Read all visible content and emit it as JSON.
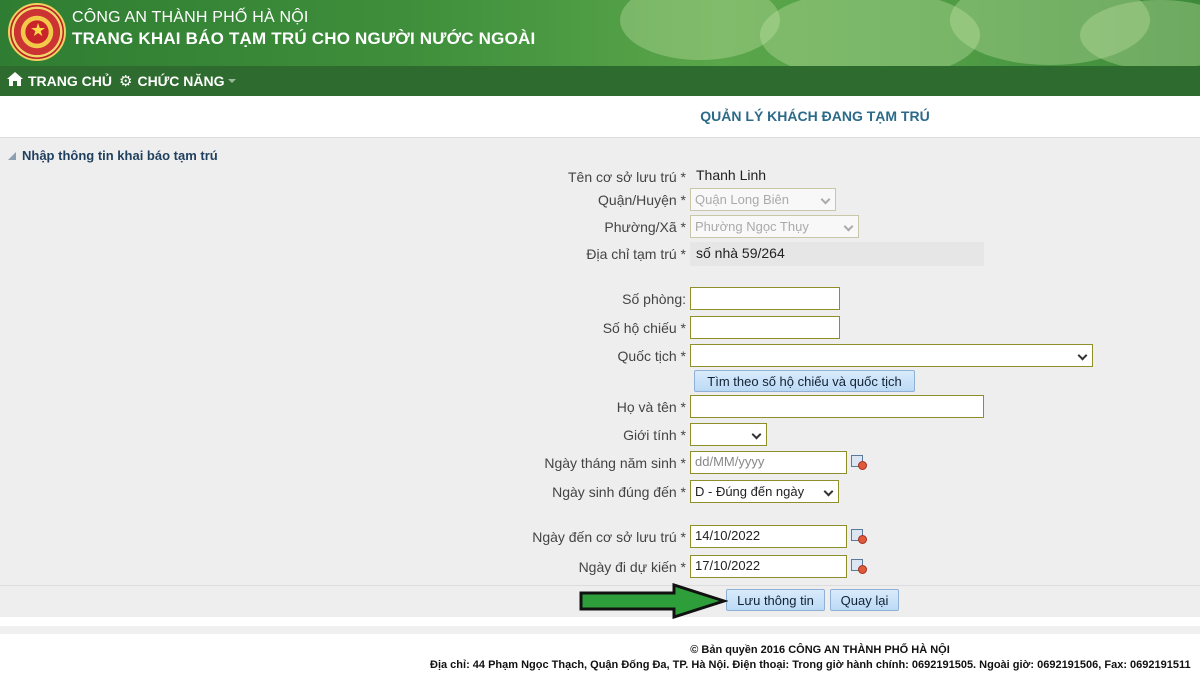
{
  "header": {
    "org_name": "CÔNG AN THÀNH PHỐ HÀ NỘI",
    "site_title": "TRANG KHAI BÁO TẠM TRÚ CHO NGƯỜI NƯỚC NGOÀI",
    "logo_icon": "police-emblem-icon"
  },
  "nav": {
    "home_label": "TRANG CHỦ",
    "home_icon": "home-icon",
    "functions_label": "CHỨC NĂNG",
    "functions_icon": "gear-icon"
  },
  "page_title": "QUẢN LÝ KHÁCH ĐANG TẠM TRÚ",
  "form": {
    "section_title": "Nhập thông tin khai báo tạm trú",
    "fields": {
      "accommodation_label": "Tên cơ sở lưu trú *",
      "accommodation_value": "Thanh Linh",
      "district_label": "Quận/Huyện *",
      "district_value": "Quận Long Biên",
      "ward_label": "Phường/Xã *",
      "ward_value": "Phường Ngọc Thụy",
      "address_label": "Địa chỉ tạm trú *",
      "address_value": "số nhà 59/264",
      "room_label": "Số phòng:",
      "room_value": "",
      "passport_label": "Số hộ chiếu *",
      "passport_value": "",
      "nationality_label": "Quốc tịch *",
      "nationality_value": "",
      "search_button": "Tìm theo số hộ chiếu và quốc tịch",
      "fullname_label": "Họ và tên *",
      "fullname_value": "",
      "gender_label": "Giới tính *",
      "gender_value": "",
      "dob_label": "Ngày tháng năm sinh *",
      "dob_placeholder": "dd/MM/yyyy",
      "dob_accuracy_label": "Ngày sinh đúng đến *",
      "dob_accuracy_value": "D - Đúng đến ngày",
      "arrival_label": "Ngày đến cơ sở lưu trú *",
      "arrival_value": "14/10/2022",
      "departure_label": "Ngày đi dự kiến *",
      "departure_value": "17/10/2022"
    },
    "save_button": "Lưu thông tin",
    "back_button": "Quay lại"
  },
  "footer": {
    "copyright": "© Bản quyền 2016 CÔNG AN THÀNH PHỐ HÀ NỘI",
    "address": "Địa chỉ: 44 Phạm Ngọc Thạch, Quận Đống Đa, TP. Hà Nội. Điện thoại: Trong giờ hành chính: 0692191505. Ngoài giờ: 0692191506, Fax: 0692191511"
  },
  "colors": {
    "banner_green": "#3f8f3c",
    "nav_green": "#2e6b2e",
    "title_blue": "#2c6a8a",
    "annotation_arrow": "#2e9e3a"
  }
}
